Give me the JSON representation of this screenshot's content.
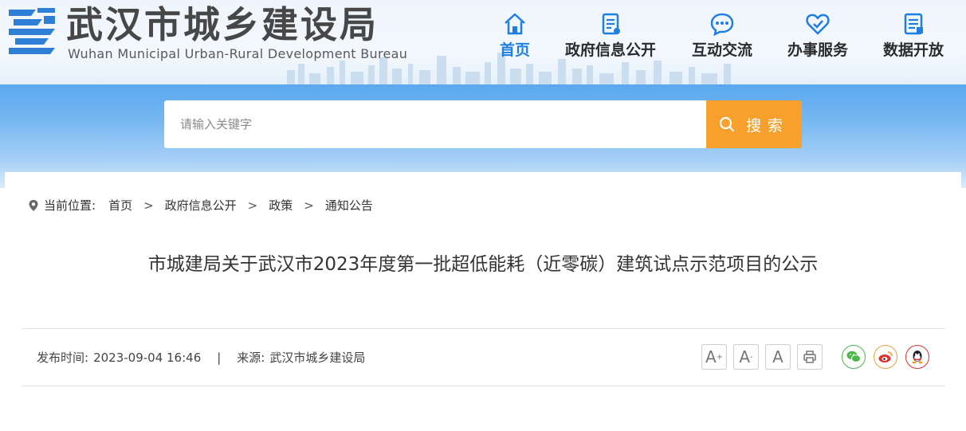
{
  "site": {
    "title_cn": "武汉市城乡建设局",
    "title_en": "Wuhan Municipal Urban-Rural Development Bureau"
  },
  "nav": {
    "items": [
      {
        "label": "首页",
        "icon": "home-icon",
        "active": true
      },
      {
        "label": "政府信息公开",
        "icon": "document-icon",
        "active": false
      },
      {
        "label": "互动交流",
        "icon": "chat-icon",
        "active": false
      },
      {
        "label": "办事服务",
        "icon": "heart-service-icon",
        "active": false
      },
      {
        "label": "数据开放",
        "icon": "data-icon",
        "active": false
      }
    ]
  },
  "search": {
    "placeholder": "请输入关键字",
    "button_label": "搜索"
  },
  "breadcrumb": {
    "prefix": "当前位置:",
    "items": [
      "首页",
      "政府信息公开",
      "政策",
      "通知公告"
    ],
    "separator": ">"
  },
  "article": {
    "title": "市城建局关于武汉市2023年度第一批超低能耗（近零碳）建筑试点示范项目的公示",
    "publish_label": "发布时间:",
    "publish_time": "2023-09-04 16:46",
    "divider": "|",
    "source_label": "来源:",
    "source": "武汉市城乡建设局"
  },
  "tools": {
    "font_increase": "A",
    "font_decrease": "A",
    "font_default": "A",
    "increase_mark": "+",
    "decrease_mark": "-"
  },
  "colors": {
    "accent_blue": "#1f7fe0",
    "search_orange": "#f7a12c",
    "wechat_green": "#4cb648",
    "weibo_orange": "#e8a040",
    "qq_red": "#d9342b"
  }
}
